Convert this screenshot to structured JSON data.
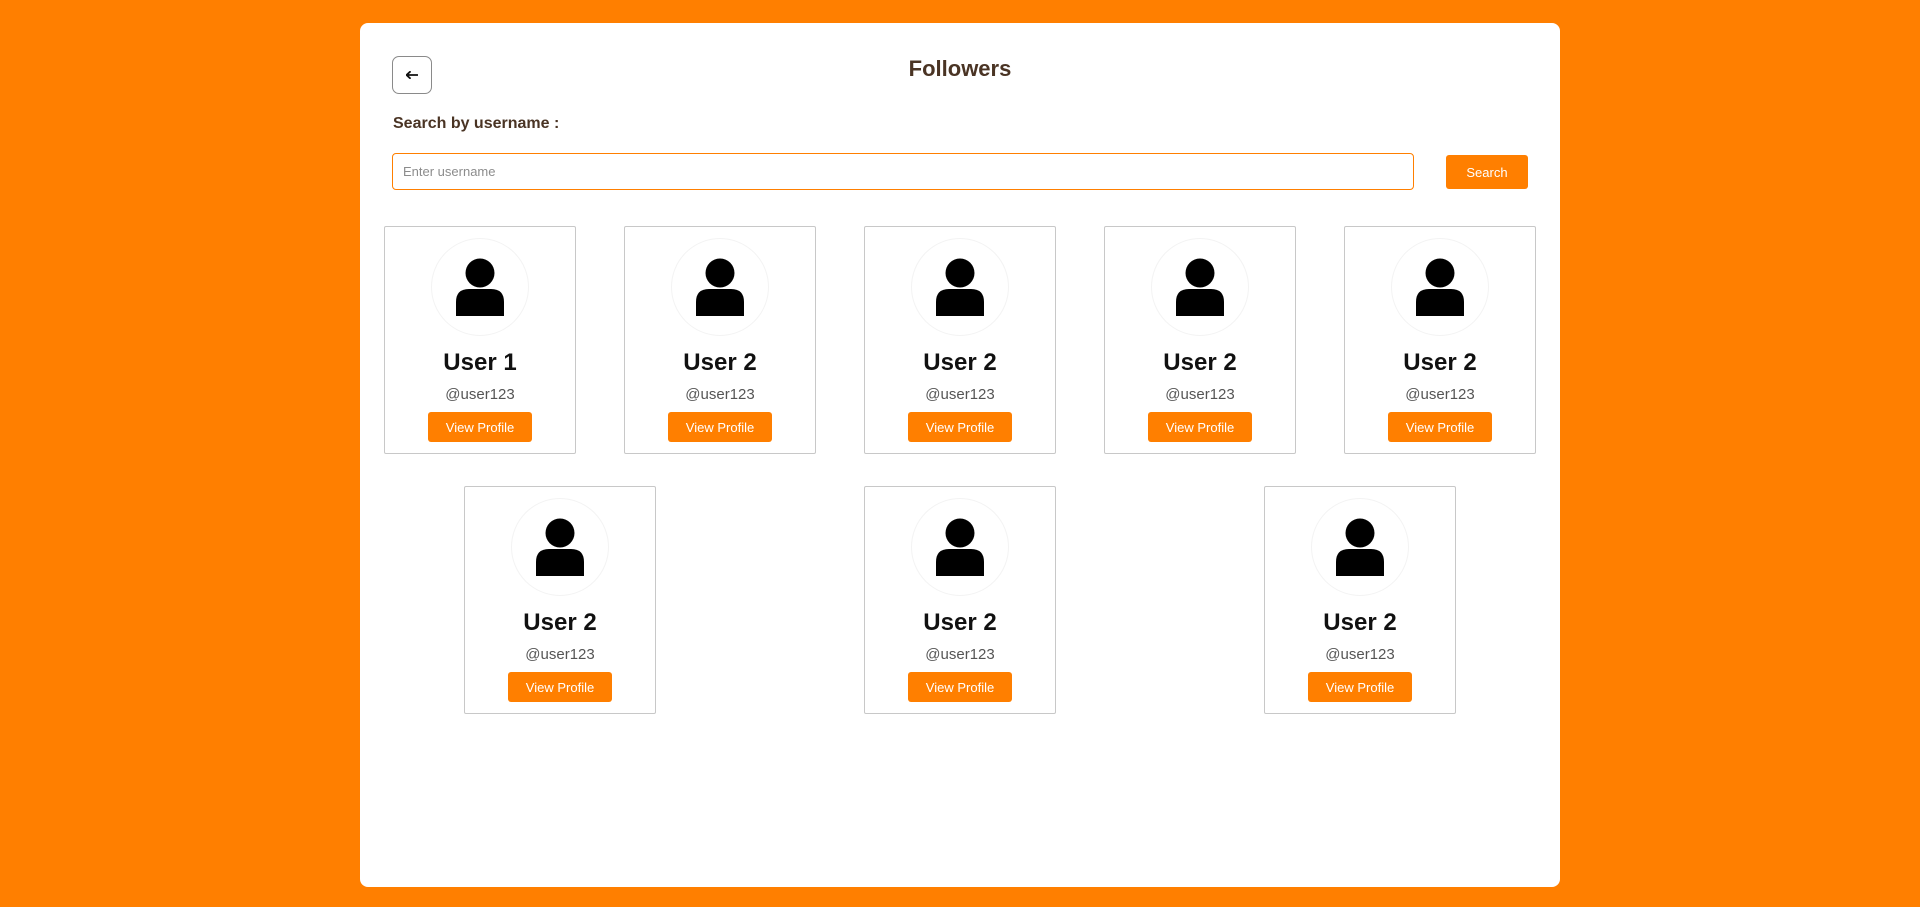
{
  "header": {
    "back_label": "←",
    "title": "Followers"
  },
  "search": {
    "label": "Search by username :",
    "placeholder": "Enter username",
    "value": "",
    "button_label": "Search"
  },
  "users": [
    {
      "name": "User 1",
      "handle": "@user123",
      "button_label": "View Profile"
    },
    {
      "name": "User 2",
      "handle": "@user123",
      "button_label": "View Profile"
    },
    {
      "name": "User 2",
      "handle": "@user123",
      "button_label": "View Profile"
    },
    {
      "name": "User 2",
      "handle": "@user123",
      "button_label": "View Profile"
    },
    {
      "name": "User 2",
      "handle": "@user123",
      "button_label": "View Profile"
    },
    {
      "name": "User 2",
      "handle": "@user123",
      "button_label": "View Profile"
    },
    {
      "name": "User 2",
      "handle": "@user123",
      "button_label": "View Profile"
    },
    {
      "name": "User 2",
      "handle": "@user123",
      "button_label": "View Profile"
    }
  ],
  "colors": {
    "accent": "#ff7f00",
    "panel": "#ffffff",
    "title_text": "#4a3424"
  },
  "icons": {
    "back": "arrow-left-icon",
    "avatar": "user-icon"
  }
}
